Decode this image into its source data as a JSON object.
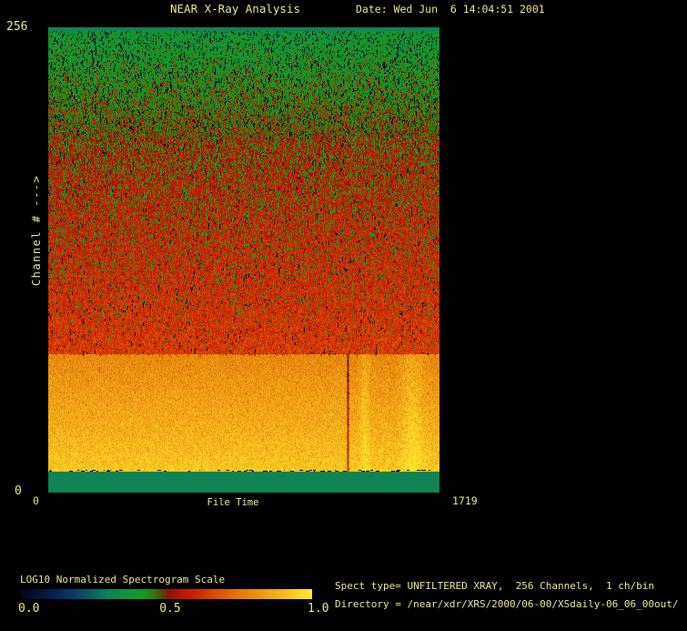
{
  "header": {
    "title": "NEAR X-Ray Analysis",
    "date": "Date: Wed Jun  6 14:04:51 2001"
  },
  "axes": {
    "y_max": "256",
    "y_min": "0",
    "y_title": "Channel # --->",
    "x_min": "0",
    "x_title": "File Time",
    "x_max": "1719"
  },
  "colorbar": {
    "title": "LOG10 Normalized Spectrogram Scale",
    "tick_left": "0.0",
    "tick_mid": "0.5",
    "tick_right": "1.0"
  },
  "info": {
    "spect_type_line": "Spect type= UNFILTERED XRAY,  256 Channels,  1 ch/bin",
    "directory_line": "Directory = /near/xdr/XRS/2000/06-00/XSdaily-06_06_00out/"
  },
  "colors": {
    "background": "#000000",
    "text": "#f0eb94",
    "solid_teal_band": "#0a8f62"
  },
  "chart_data": {
    "type": "heatmap",
    "title": "NEAR X-Ray Analysis",
    "xlabel": "File Time",
    "ylabel": "Channel # --->",
    "xlim": [
      0,
      1719
    ],
    "ylim": [
      0,
      256
    ],
    "scale_label": "LOG10 Normalized Spectrogram Scale",
    "scale_ticks": [
      0.0,
      0.5,
      1.0
    ],
    "legend_position": "bottom-left",
    "colormap_stops": [
      [
        0.0,
        "#020312"
      ],
      [
        0.05,
        "#050e33"
      ],
      [
        0.12,
        "#082151"
      ],
      [
        0.18,
        "#0b3a62"
      ],
      [
        0.24,
        "#0d5b64"
      ],
      [
        0.3,
        "#0e8158"
      ],
      [
        0.36,
        "#109140"
      ],
      [
        0.42,
        "#149a22"
      ],
      [
        0.46,
        "#2e7a0e"
      ],
      [
        0.485,
        "#5c4306"
      ],
      [
        0.51,
        "#8a1505"
      ],
      [
        0.55,
        "#bb1404"
      ],
      [
        0.6,
        "#cc2404"
      ],
      [
        0.67,
        "#d84e05"
      ],
      [
        0.74,
        "#e27309"
      ],
      [
        0.82,
        "#ec9512"
      ],
      [
        0.9,
        "#f5b91c"
      ],
      [
        0.96,
        "#fcd727"
      ],
      [
        1.0,
        "#ffe930"
      ]
    ],
    "bands": [
      {
        "name": "bottom-solid-teal",
        "channels": [
          0,
          11.5
        ],
        "value": 0.315,
        "noise": 0
      },
      {
        "name": "bright-yellow-band",
        "channels": [
          11.5,
          76
        ],
        "value_at_bottom": 0.93,
        "value_at_top": 0.79,
        "noise": 0.09
      },
      {
        "name": "red-band",
        "channels": [
          76,
          196
        ],
        "value_at_bottom": 0.64,
        "value_at_top": 0.55,
        "noise": 0.1
      },
      {
        "name": "green-noise-band",
        "channels": [
          196,
          254
        ],
        "value_at_bottom": 0.46,
        "value_at_top": 0.4,
        "noise": 0.08
      },
      {
        "name": "top-solid-teal",
        "channels": [
          254,
          256
        ],
        "value": 0.315,
        "noise": 0
      }
    ],
    "features": {
      "dark_vertical_streak_time": 1315,
      "bright_vertical_streak_times": [
        1390,
        1600
      ],
      "black_dash_row_channel": 12
    }
  }
}
